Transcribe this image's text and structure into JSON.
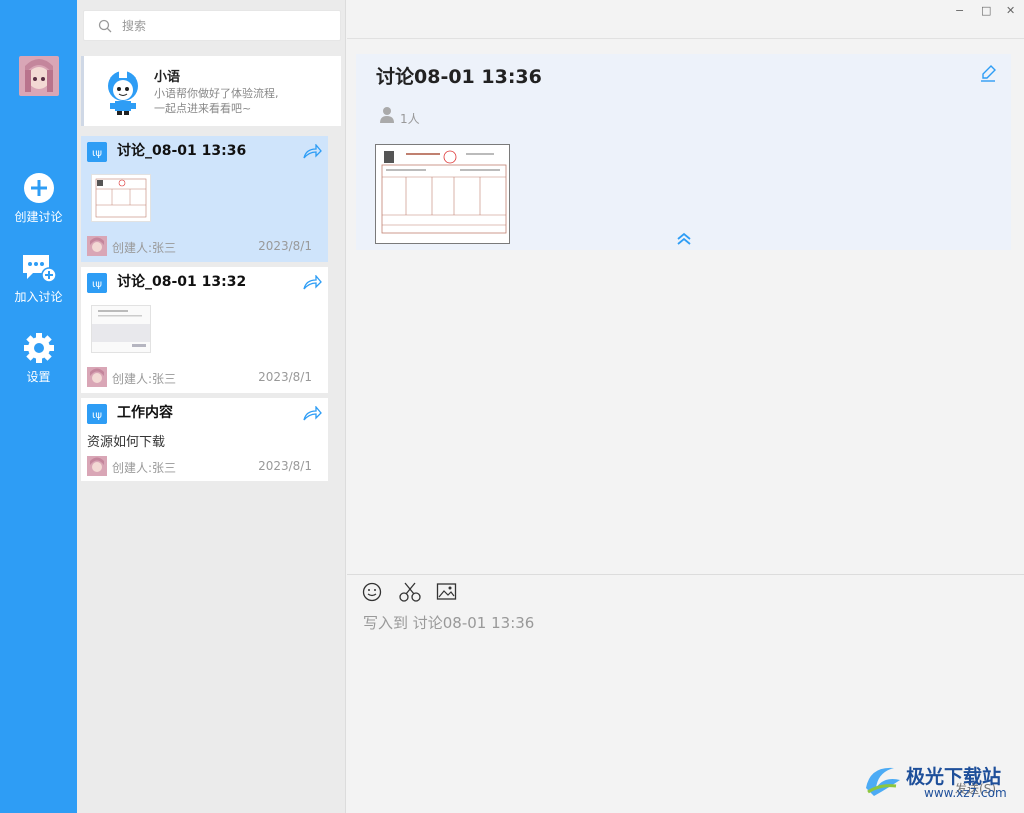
{
  "nav": {
    "create_label": "创建讨论",
    "join_label": "加入讨论",
    "settings_label": "设置"
  },
  "search": {
    "placeholder": "搜索"
  },
  "bot": {
    "name": "小语",
    "desc_line1": "小语帮你做好了体验流程,",
    "desc_line2": "一起点进来看看吧~"
  },
  "discussions": [
    {
      "title": "讨论_08-01 13:36",
      "creator": "创建人:张三",
      "date": "2023/8/1"
    },
    {
      "title": "讨论_08-01 13:32",
      "creator": "创建人:张三",
      "date": "2023/8/1"
    },
    {
      "title": "工作内容",
      "text": "资源如何下载",
      "creator": "创建人:张三",
      "date": "2023/8/1"
    }
  ],
  "detail": {
    "title": "讨论08-01 13:36",
    "members": "1人"
  },
  "composer": {
    "placeholder": "写入到 讨论08-01 13:36",
    "send_label": "发送(S)"
  },
  "window": {
    "minimize": "▫",
    "maximize": "□",
    "close": "✕"
  },
  "watermark": {
    "name": "极光下载站",
    "url": "www.xz7.com"
  },
  "colors": {
    "accent": "#2e9df5",
    "selected": "#cfe4fb",
    "panel": "#edf2fa"
  }
}
